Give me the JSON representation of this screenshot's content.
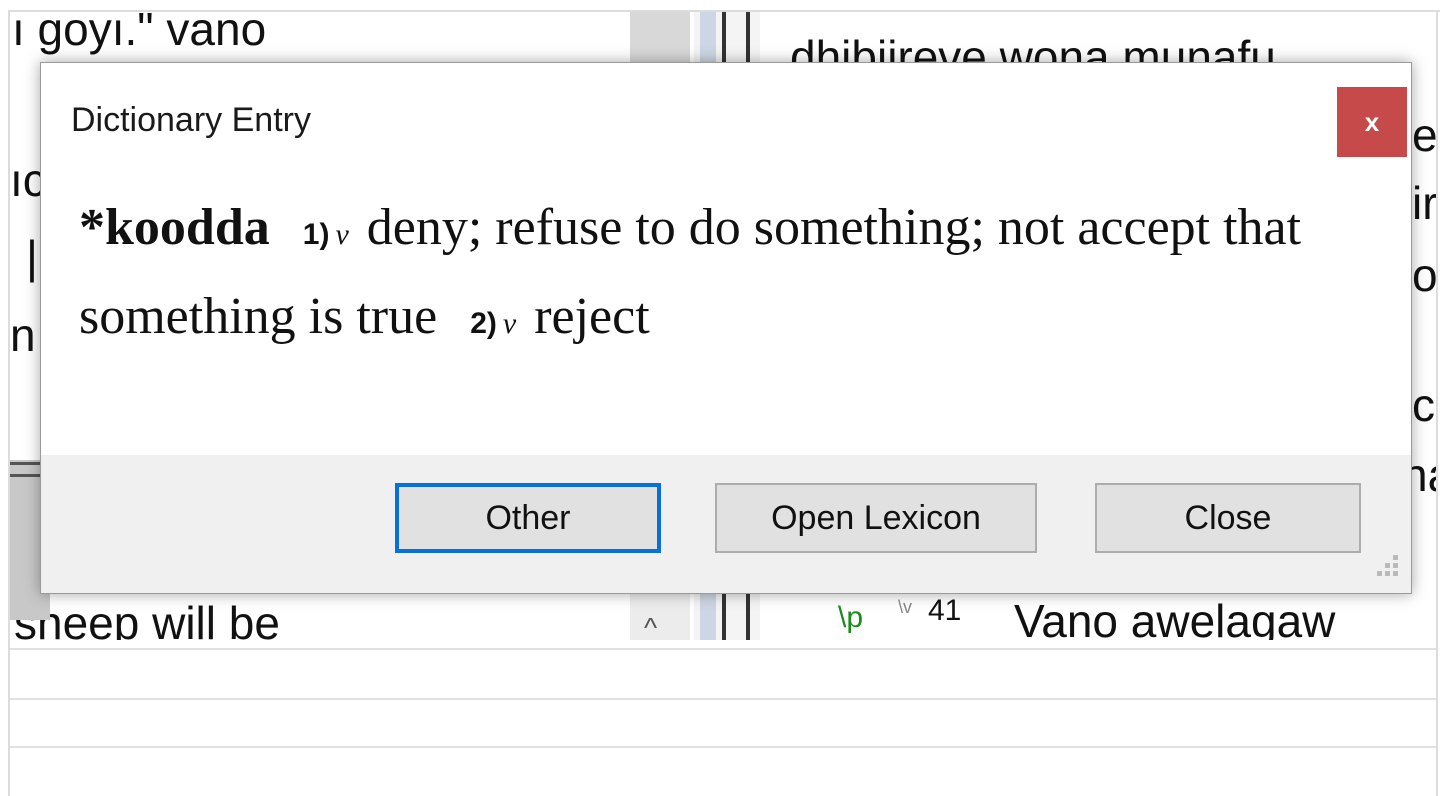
{
  "background": {
    "left_pane": {
      "line_top": "ı goyı.\" vano",
      "line_bottom": "sheep will be",
      "fragments": [
        "ıc",
        "|",
        "n",
        "."
      ]
    },
    "right_pane": {
      "line_top": "dhibiireve wona munafu",
      "line_bottom": "Vano awelagaw",
      "marker_p": "\\p",
      "marker_v": "\\v",
      "verse_num": "41",
      "fragments": [
        "e",
        "ir",
        "o",
        "c",
        "na"
      ]
    }
  },
  "dialog": {
    "title": "Dictionary Entry",
    "close_icon": "x",
    "entry": {
      "headword": "*koodda",
      "senses": [
        {
          "num": "1)",
          "pos": "v",
          "gloss": "deny; refuse to do something; not accept that something is true"
        },
        {
          "num": "2)",
          "pos": "v",
          "gloss": "reject"
        }
      ]
    },
    "buttons": {
      "other": "Other",
      "open_lexicon": "Open Lexicon",
      "close": "Close"
    },
    "close_button_color": "#c74a4a",
    "focus_color": "#0a6fd6"
  }
}
